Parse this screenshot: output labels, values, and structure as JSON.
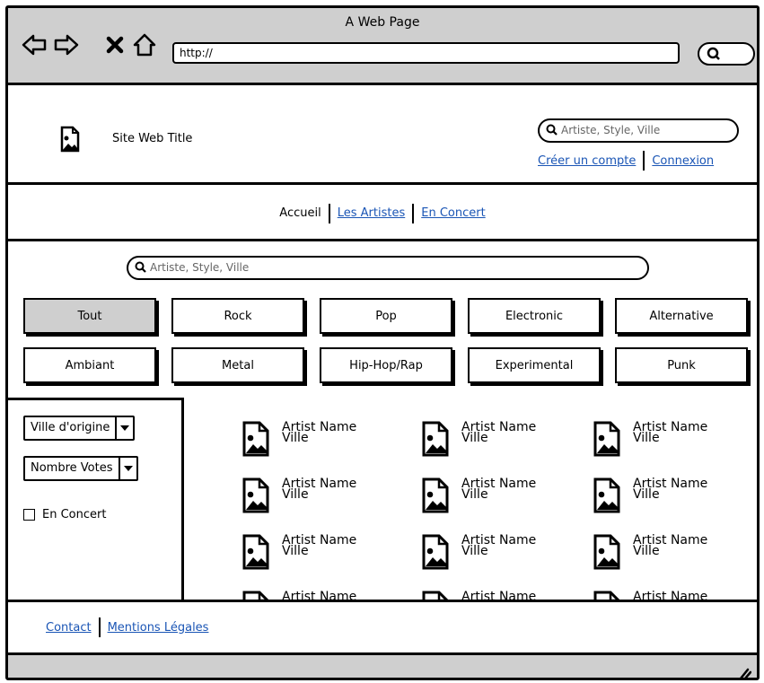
{
  "browser": {
    "title": "A Web Page",
    "address": "http://"
  },
  "header": {
    "site_title": "Site Web Title",
    "search_placeholder": "Artiste, Style, Ville",
    "create_account": "Créer un compte",
    "login": "Connexion"
  },
  "nav": {
    "home": "Accueil",
    "artists": "Les Artistes",
    "concerts": "En Concert"
  },
  "main_search_placeholder": "Artiste, Style, Ville",
  "categories": [
    "Tout",
    "Rock",
    "Pop",
    "Electronic",
    "Alternative",
    "Ambiant",
    "Metal",
    "Hip-Hop/Rap",
    "Experimental",
    "Punk"
  ],
  "active_category": "Tout",
  "filters": {
    "origin_select": "Ville d'origine",
    "votes_select": "Nombre Votes",
    "in_concert_label": "En Concert"
  },
  "artist_card": {
    "name": "Artist Name",
    "city": "Ville"
  },
  "footer": {
    "contact": "Contact",
    "legal": "Mentions Légales"
  },
  "colors": {
    "link": "#1a55b5",
    "chrome": "#cfcfcf"
  }
}
